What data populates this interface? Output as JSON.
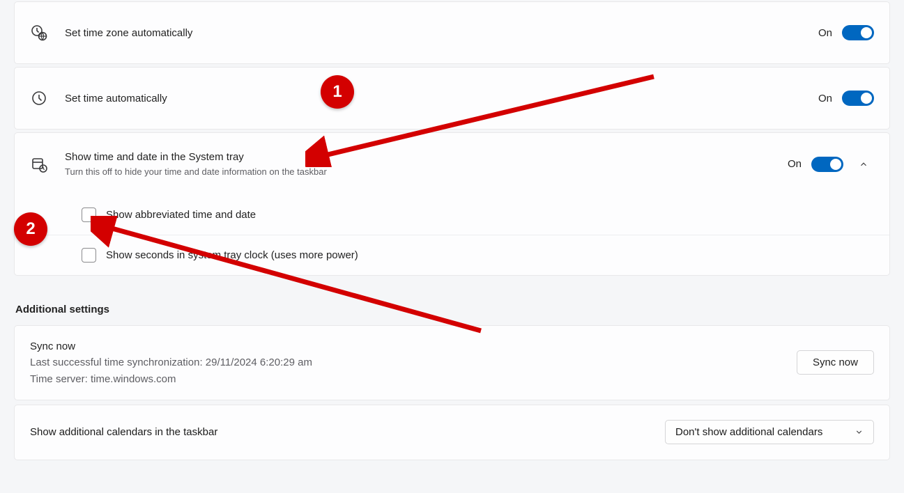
{
  "settings": {
    "set_timezone_auto": {
      "label": "Set time zone automatically",
      "state_label": "On",
      "on": true
    },
    "set_time_auto": {
      "label": "Set time automatically",
      "state_label": "On",
      "on": true
    },
    "show_systray": {
      "label": "Show time and date in the System tray",
      "description": "Turn this off to hide your time and date information on the taskbar",
      "state_label": "On",
      "on": true,
      "sub": {
        "abbreviated": {
          "label": "Show abbreviated time and date",
          "checked": false
        },
        "seconds": {
          "label": "Show seconds in system tray clock (uses more power)",
          "checked": false
        }
      }
    }
  },
  "additional": {
    "heading": "Additional settings",
    "sync": {
      "title": "Sync now",
      "last_sync": "Last successful time synchronization: 29/11/2024 6:20:29 am",
      "server": "Time server: time.windows.com",
      "button": "Sync now"
    },
    "calendars": {
      "label": "Show additional calendars in the taskbar",
      "selected": "Don't show additional calendars"
    }
  },
  "annotations": {
    "badge1": "1",
    "badge2": "2"
  }
}
